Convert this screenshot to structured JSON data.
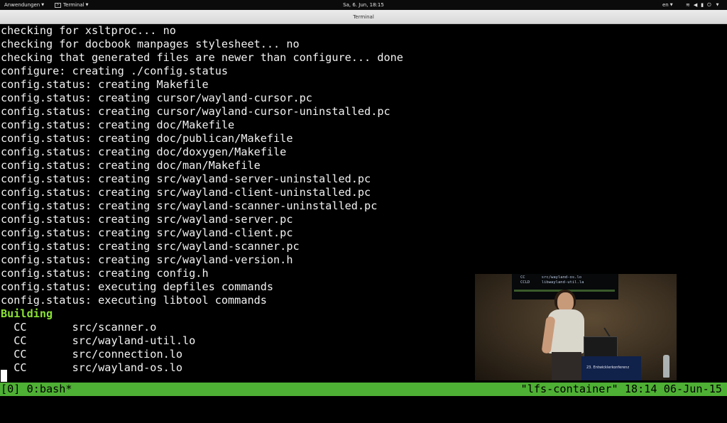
{
  "topbar": {
    "apps_label": "Anwendungen",
    "terminal_label": "Terminal",
    "clock": "Sa, 6. Jun, 18:15",
    "lang": "en"
  },
  "window": {
    "title": "Terminal"
  },
  "terminal": {
    "lines": [
      "checking for xsltproc... no",
      "checking for docbook manpages stylesheet... no",
      "checking that generated files are newer than configure... done",
      "configure: creating ./config.status",
      "config.status: creating Makefile",
      "config.status: creating cursor/wayland-cursor.pc",
      "config.status: creating cursor/wayland-cursor-uninstalled.pc",
      "config.status: creating doc/Makefile",
      "config.status: creating doc/publican/Makefile",
      "config.status: creating doc/doxygen/Makefile",
      "config.status: creating doc/man/Makefile",
      "config.status: creating src/wayland-server-uninstalled.pc",
      "config.status: creating src/wayland-client-uninstalled.pc",
      "config.status: creating src/wayland-scanner-uninstalled.pc",
      "config.status: creating src/wayland-server.pc",
      "config.status: creating src/wayland-client.pc",
      "config.status: creating src/wayland-scanner.pc",
      "config.status: creating src/wayland-version.h",
      "config.status: creating config.h",
      "config.status: executing depfiles commands",
      "config.status: executing libtool commands",
      "Building",
      "  CC       src/scanner.o",
      "  CC       src/wayland-util.lo",
      "  CC       src/connection.lo",
      "  CC       src/wayland-os.lo"
    ]
  },
  "tmux": {
    "left": "[0] 0:bash*",
    "right": "\"lfs-container\" 18:14 06-Jun-15"
  },
  "video_overlay": {
    "screen_lines": [
      "CC       src/wayland-os.lo",
      "CCLD     libwayland-util.la"
    ],
    "podium_text": "23. Entwicklerkonferenz"
  },
  "colors": {
    "terminal_bg": "#000000",
    "terminal_fg": "#f2f2f2",
    "building_green": "#8ae234",
    "tmux_status_bg": "#4eb034"
  },
  "icons": [
    "wifi-icon",
    "volume-icon",
    "battery-icon",
    "power-icon",
    "terminal-icon"
  ]
}
